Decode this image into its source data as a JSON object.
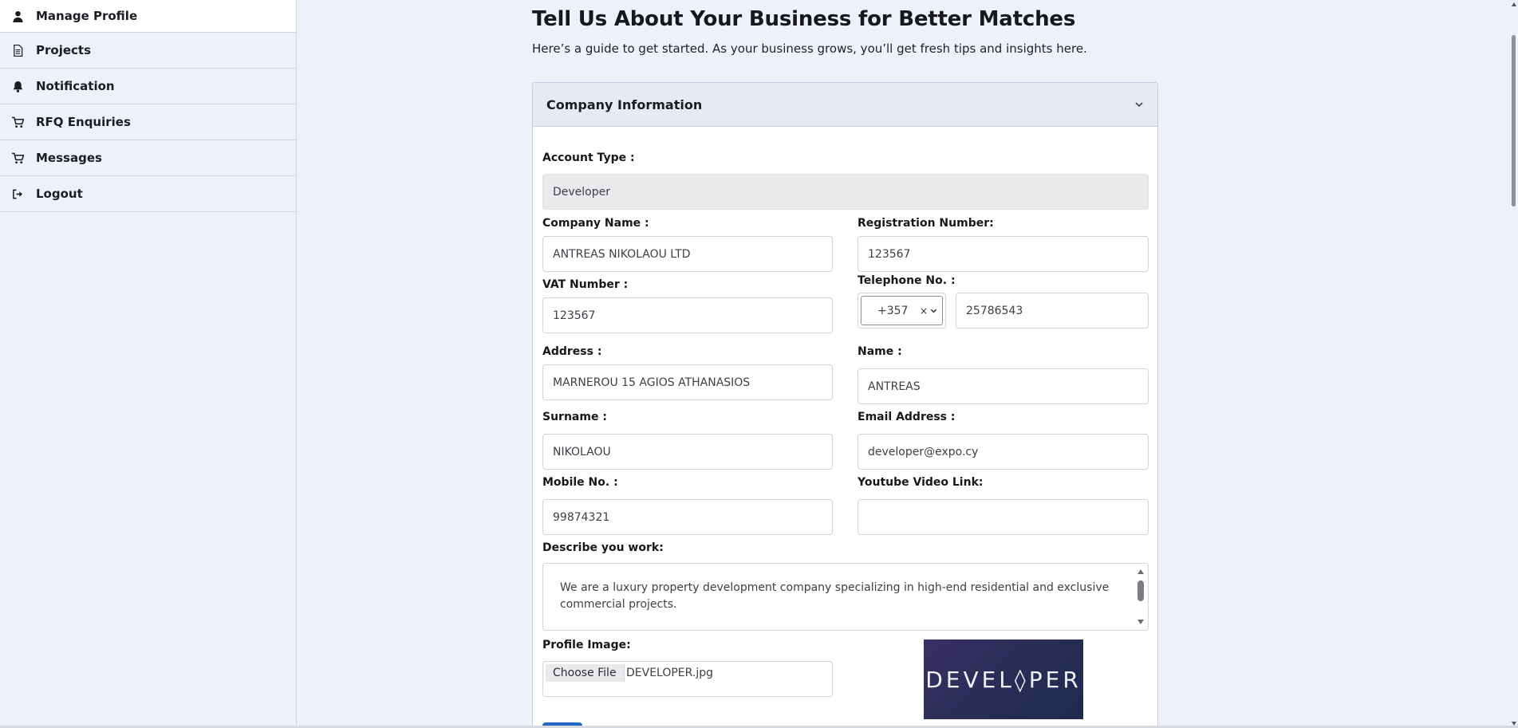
{
  "sidebar": {
    "items": [
      {
        "label": "Manage Profile",
        "icon": "user-icon"
      },
      {
        "label": "Projects",
        "icon": "file-icon"
      },
      {
        "label": "Notification",
        "icon": "bell-icon"
      },
      {
        "label": "RFQ Enquiries",
        "icon": "cart-icon"
      },
      {
        "label": "Messages",
        "icon": "cart-icon"
      },
      {
        "label": "Logout",
        "icon": "logout-icon"
      }
    ]
  },
  "header": {
    "title": "Tell Us About Your Business for Better Matches",
    "subtitle": "Here’s a guide to get started. As your business grows, you’ll get fresh tips and insights here."
  },
  "section": {
    "title": "Company Information"
  },
  "form": {
    "account_type": {
      "label": "Account Type :",
      "value": "Developer"
    },
    "company_name": {
      "label": "Company Name :",
      "value": "ANTREAS NIKOLAOU LTD"
    },
    "registration_number": {
      "label": "Registration Number:",
      "value": "123567"
    },
    "vat_number": {
      "label": "VAT Number :",
      "value": "123567"
    },
    "telephone": {
      "label": "Telephone No. :",
      "country_code": "+357",
      "clear": "×",
      "value": "25786543"
    },
    "address": {
      "label": "Address :",
      "value": "MARNEROU 15 AGIOS ATHANASIOS"
    },
    "name": {
      "label": "Name :",
      "value": "ANTREAS"
    },
    "surname": {
      "label": "Surname :",
      "value": "NIKOLAOU"
    },
    "email": {
      "label": "Email Address :",
      "value": "developer@expo.cy"
    },
    "mobile": {
      "label": "Mobile No. :",
      "value": "99874321"
    },
    "youtube": {
      "label": "Youtube Video Link:",
      "value": ""
    },
    "describe": {
      "label": "Describe you work:",
      "line1": "We are a luxury property development company specializing in high-end residential and exclusive",
      "line2": "commercial projects."
    },
    "profile_image": {
      "label": "Profile Image:",
      "button": "Choose File",
      "file_name": "DEVELOPER.jpg",
      "preview_text": "DEVEL◊PER"
    }
  },
  "colors": {
    "background": "#eef1f9",
    "primary_button": "#2466c0"
  }
}
